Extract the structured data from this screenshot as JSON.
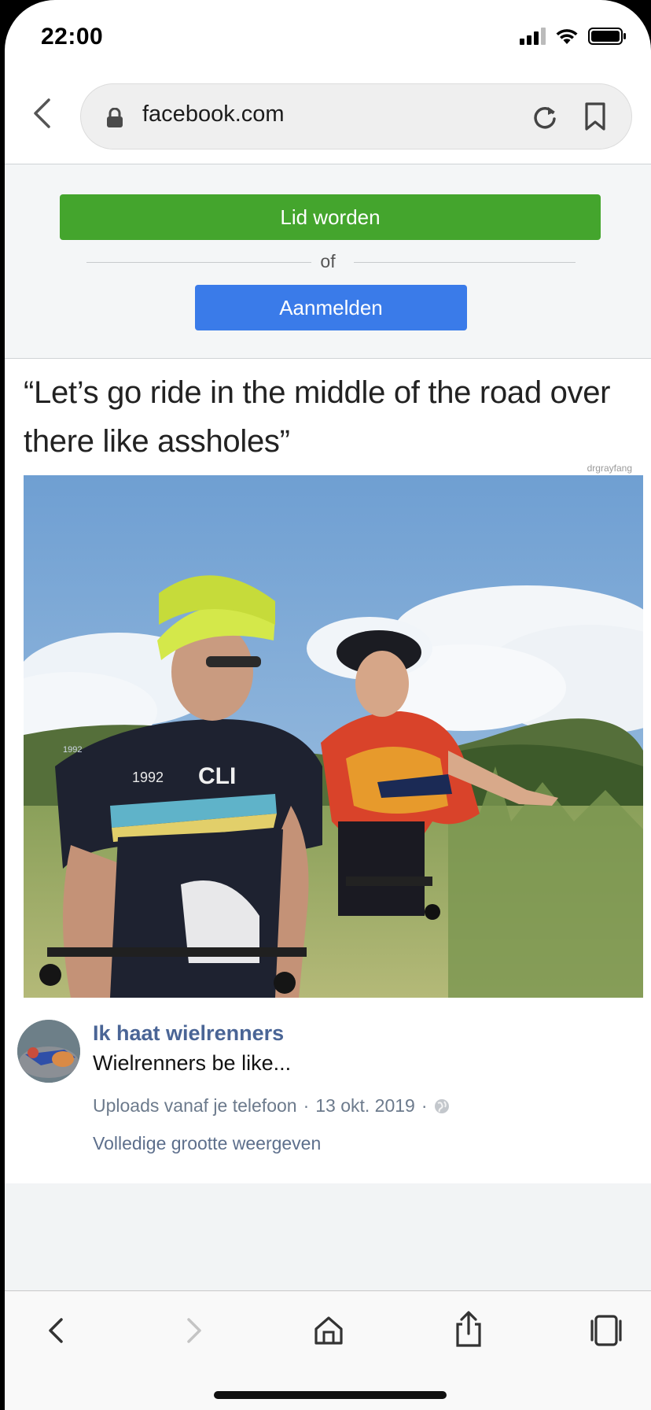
{
  "status_bar": {
    "time": "22:00"
  },
  "browser": {
    "url": "facebook.com"
  },
  "login": {
    "join_label": "Lid worden",
    "or_label": "of",
    "login_label": "Aanmelden"
  },
  "post": {
    "caption": "“Let’s go ride in the middle of the road over there like assholes”",
    "watermark": "drgrayfang",
    "page_name": "Ik haat wielrenners",
    "text": "Wielrenners be like...",
    "source": "Uploads vanaf je telefoon",
    "date": "13 okt. 2019",
    "full_size_link": "Volledige grootte weergeven"
  },
  "photo_jersey_texts": [
    "1992",
    "CLI",
    "1992"
  ],
  "icons": [
    "back-icon",
    "lock-icon",
    "reload-icon",
    "bookmark-icon",
    "globe-icon",
    "home-icon",
    "share-icon",
    "tabs-icon",
    "forward-icon"
  ]
}
